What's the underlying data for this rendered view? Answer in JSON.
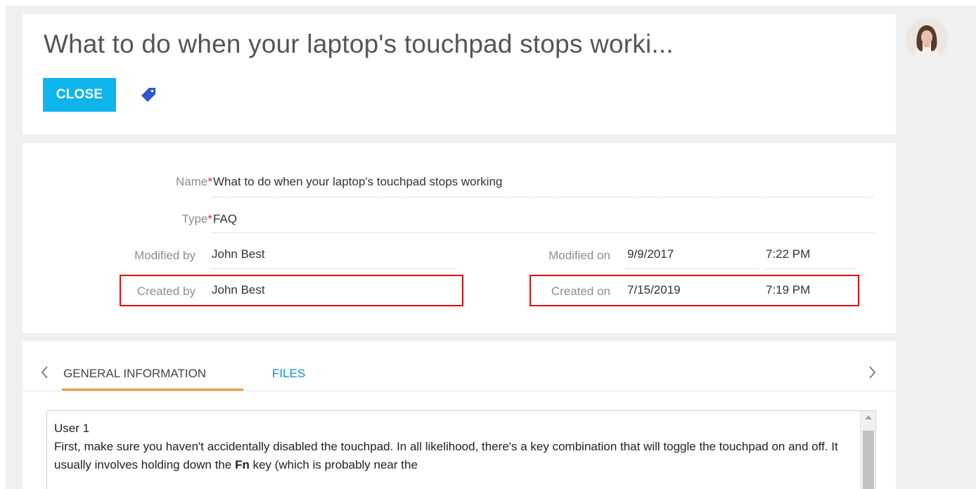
{
  "header": {
    "title": "What to do when your laptop's touchpad stops worki...",
    "close_label": "CLOSE",
    "tag_icon": "tag-icon"
  },
  "user": {
    "avatar_icon": "user-avatar"
  },
  "fields": {
    "name": {
      "label": "Name",
      "required_mark": "*",
      "value": "What to do when your laptop's touchpad stops working"
    },
    "type": {
      "label": "Type",
      "required_mark": "*",
      "value": "FAQ"
    },
    "modified_by": {
      "label": "Modified by",
      "value": "John Best"
    },
    "created_by": {
      "label": "Created by",
      "value": "John Best"
    },
    "modified_on": {
      "label": "Modified on",
      "date": "9/9/2017",
      "time": "7:22 PM"
    },
    "created_on": {
      "label": "Created on",
      "date": "7/15/2019",
      "time": "7:19 PM"
    }
  },
  "tabs": {
    "items": [
      {
        "label": "GENERAL INFORMATION",
        "active": true
      },
      {
        "label": "FILES",
        "active": false
      }
    ],
    "prev_icon": "chevron-left-icon",
    "next_icon": "chevron-right-icon"
  },
  "editor": {
    "heading": "User 1",
    "text_part1": "First, make sure you haven't accidentally disabled the touchpad. In all likelihood, there's a key combination that will toggle the touchpad on and off. It usually involves holding down the ",
    "text_bold": "Fn",
    "text_part2": " key (which is probably near the"
  },
  "colors": {
    "accent": "#0db5ec",
    "tab_active_underline": "#f09a47",
    "link": "#0c8ec9",
    "required": "#e0212a",
    "highlight_box": "#e00c0c"
  }
}
